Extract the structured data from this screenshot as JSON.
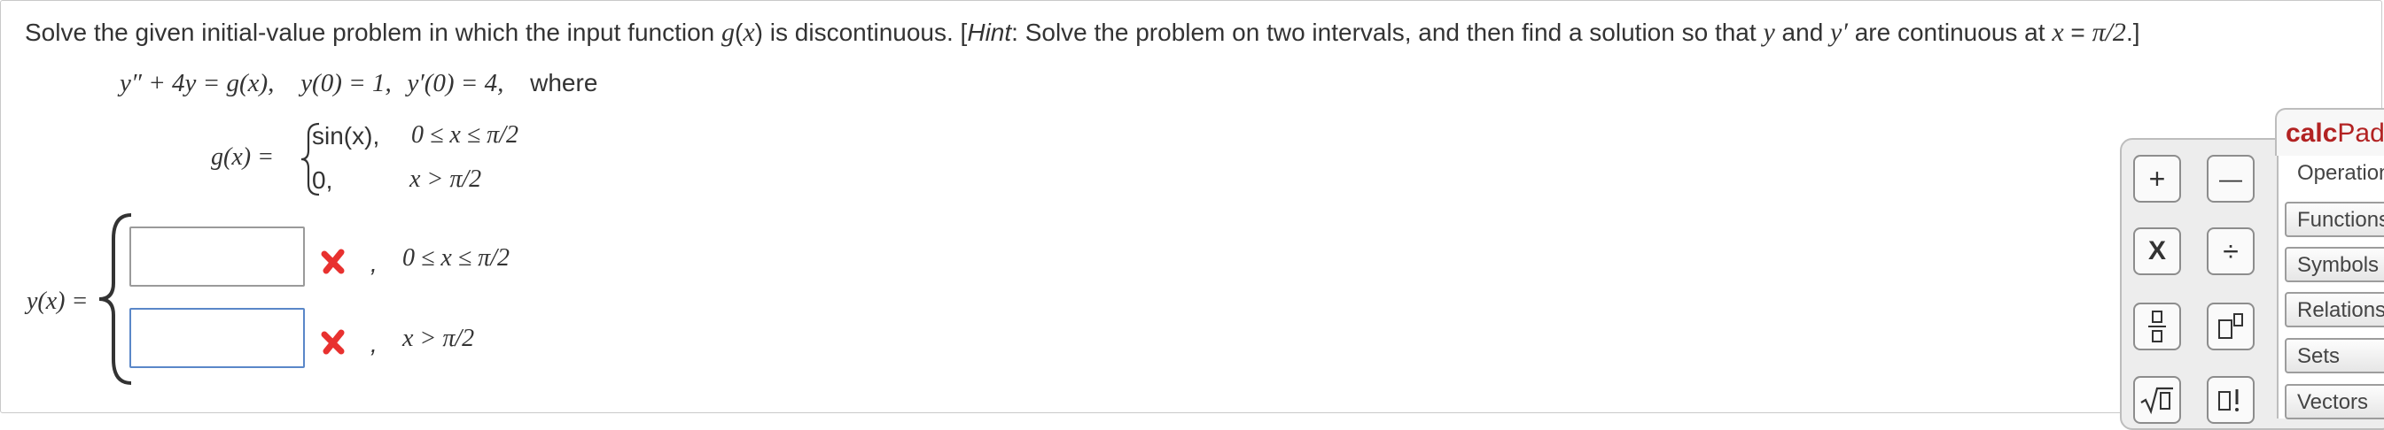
{
  "problem": {
    "text_1": "Solve the given initial-value problem in which the input function ",
    "g_symbol": "g",
    "text_2": "(",
    "x_symbol": "x",
    "text_3": ") is discontinuous. [",
    "hint_word": "Hint",
    "text_4": ": Solve the problem on two intervals, and then find a solution so that ",
    "y_symbol": "y",
    "text_5": " and ",
    "yprime_symbol": "y′",
    "text_6": " are continuous at ",
    "x_symbol_2": "x",
    "text_7": " = ",
    "pi_half": "π/2",
    "text_8": ".]"
  },
  "equation": {
    "ode": "y″ + 4y = g(x),",
    "init_y": "y(0) = 1,",
    "init_yp": "y′(0) = 4,",
    "where": "where"
  },
  "g_def": {
    "label": "g(x) =",
    "case1_value": "sin(x),",
    "case1_condition": "0 ≤ x ≤ π/2",
    "case2_value": "0,",
    "case2_condition": "x > π/2"
  },
  "answer": {
    "label": "y(x) =",
    "field1_value": "",
    "field2_value": "",
    "comma": ",",
    "interval1": "0 ≤ x ≤ π/2",
    "interval2": "x > π/2"
  },
  "calcpad": {
    "title_calc": "calc",
    "title_pad": "Pad",
    "operations_tab": "Operations",
    "keys": {
      "plus": "+",
      "minus": "—",
      "times": "X",
      "divide": "÷",
      "power": "▯▯"
    },
    "menu": [
      "Functions",
      "Symbols",
      "Relations",
      "Sets",
      "Vectors"
    ]
  },
  "colors": {
    "error_red": "#e8312f",
    "active_blue": "#5a87c8",
    "brand_red": "#b22222"
  }
}
